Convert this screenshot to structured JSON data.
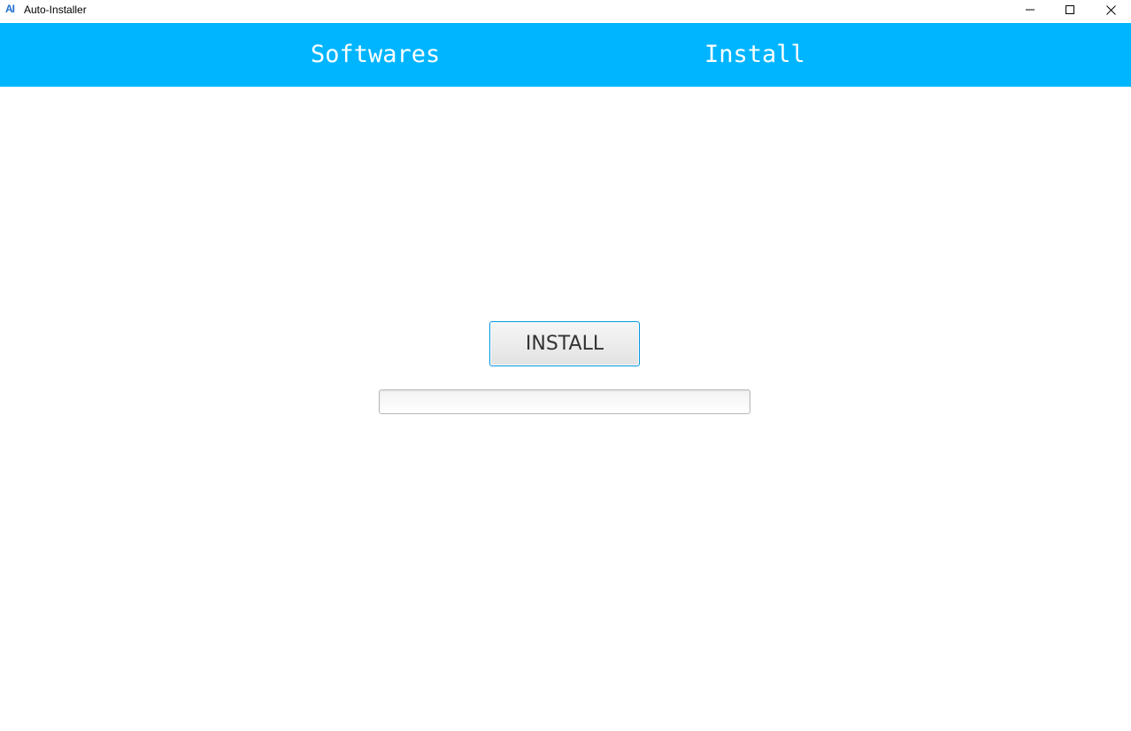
{
  "window": {
    "title": "Auto-Installer",
    "logo_text": "AI",
    "controls": {
      "minimize_icon": "minimize-icon",
      "maximize_icon": "maximize-icon",
      "close_icon": "close-icon"
    }
  },
  "header": {
    "background_color": "#00b5ff",
    "tabs": [
      {
        "label": "Softwares"
      },
      {
        "label": "Install"
      }
    ]
  },
  "main": {
    "install_button_label": "INSTALL",
    "progress": {
      "value": 0
    }
  }
}
